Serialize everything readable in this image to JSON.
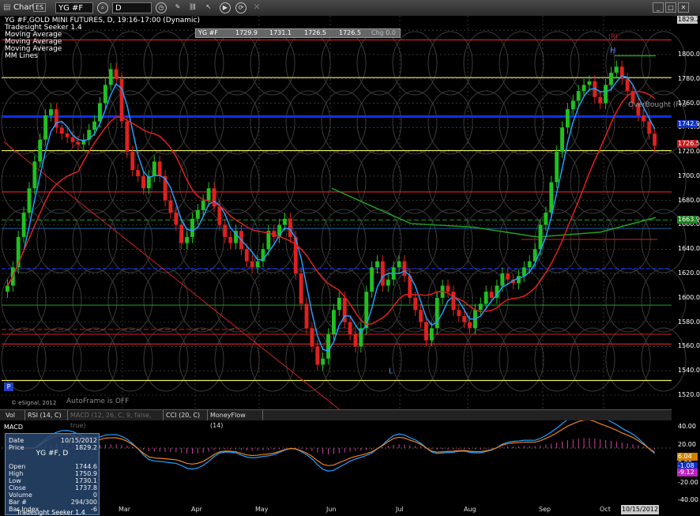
{
  "toolbar": {
    "chart_label": "Chart",
    "badge": "ES",
    "symbol": "YG #F",
    "interval": "D"
  },
  "studies": [
    "YG #F,GOLD MINI FUTURES, D, 19:16-17:00 (Dynamic)",
    "Tradesight Seeker 1.4",
    "Moving Average",
    "Moving Average",
    "Moving Average",
    "MM Lines"
  ],
  "quote_bar": {
    "symbol": "YG #F",
    "open": "1729.9",
    "high": "1731.1",
    "low": "1726.5",
    "close": "1726.5",
    "change": "Chg 0.0"
  },
  "price_axis": {
    "labels": [
      "1829.2",
      "1800.0",
      "1780.0",
      "1760.0",
      "1740.0",
      "1720.0",
      "1700.0",
      "1680.0",
      "1660.0",
      "1640.0",
      "1620.0",
      "1600.0",
      "1580.0",
      "1560.0",
      "1540.0",
      "1520.0"
    ],
    "badges": [
      {
        "text": "1742.9",
        "color": "#1030c0"
      },
      {
        "text": "1726.5",
        "color": "#c02020"
      },
      {
        "text": "1663.9",
        "color": "#208020"
      }
    ]
  },
  "macd_axis": {
    "labels": [
      "40.00",
      "20.00",
      "0.00",
      "-20.00",
      "-40.00"
    ],
    "badges": [
      {
        "text": "6.04",
        "color": "#d08000"
      },
      {
        "text": "-1.08",
        "color": "#1030c0"
      },
      {
        "text": "-9.12",
        "color": "#c020c0"
      }
    ]
  },
  "months": [
    "Mar",
    "Apr",
    "May",
    "Jun",
    "Jul",
    "Aug",
    "Sep",
    "Oct"
  ],
  "date_badge": "10/15/2012",
  "annotations": {
    "resistance_tag": "(R)",
    "high_tag": "H",
    "low_tag": "L",
    "overbought_text": "OverBought (Fra",
    "copyright": "© eSignal, 2012",
    "autoframe": "AutoFrame is OFF",
    "p_button": "P",
    "macd_title": "MACD"
  },
  "tabs": [
    {
      "label": "Vol",
      "dim": false
    },
    {
      "label": "RSI (14, C)",
      "dim": false
    },
    {
      "label": "MACD (12, 26, C, 9, false, true)",
      "dim": true
    },
    {
      "label": "CCI (20, C)",
      "dim": false
    },
    {
      "label": "MoneyFlow (14)",
      "dim": false
    }
  ],
  "info_panel": {
    "title": "YG #F, D",
    "rows": [
      {
        "k": "Date",
        "v": "10/15/2012"
      },
      {
        "k": "Price",
        "v": "1829.2"
      },
      {
        "k": "Open",
        "v": "1744.6"
      },
      {
        "k": "High",
        "v": "1750.9"
      },
      {
        "k": "Low",
        "v": "1730.1"
      },
      {
        "k": "Close",
        "v": "1737.8"
      },
      {
        "k": "Volume",
        "v": "0"
      },
      {
        "k": "Bar #",
        "v": "294/300"
      },
      {
        "k": "Bar Index",
        "v": "-6"
      }
    ],
    "footer": "Tradesight Seeker 1.4"
  },
  "colors": {
    "up": "#20c020",
    "down": "#e02020",
    "ma_fast": "#20a0ff",
    "ma_mid": "#e02020",
    "ma_slow": "#20a020",
    "blue_line": "#1030e0",
    "yellow_line": "#f0f060",
    "red_line": "#d02020"
  }
}
